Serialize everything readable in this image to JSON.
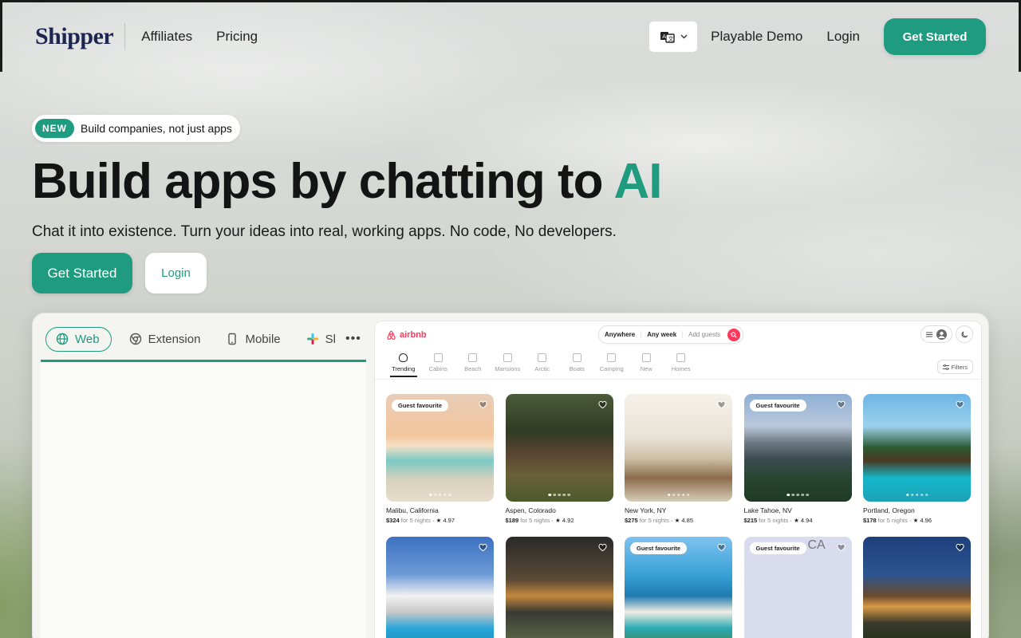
{
  "header": {
    "logo": "Shipper",
    "nav": [
      "Affiliates",
      "Pricing"
    ],
    "language_icon": "translate-icon",
    "playable_demo": "Playable Demo",
    "login": "Login",
    "get_started": "Get Started"
  },
  "hero": {
    "badge_label": "NEW",
    "badge_text": "Build companies, not just apps",
    "title_main": "Build apps by chatting to ",
    "title_accent": "AI",
    "subtitle": "Chat it into existence. Turn your ideas into real, working apps. No code, No developers.",
    "cta_primary": "Get Started",
    "cta_secondary": "Login"
  },
  "demo": {
    "tabs": [
      {
        "label": "Web",
        "icon": "globe-icon",
        "active": true
      },
      {
        "label": "Extension",
        "icon": "chrome-icon",
        "active": false
      },
      {
        "label": "Mobile",
        "icon": "phone-icon",
        "active": false
      },
      {
        "label": "Sl",
        "icon": "slack-icon",
        "active": false
      }
    ],
    "more": "•••",
    "accent_color": "#1f9b7f"
  },
  "airbnb": {
    "logo": "airbnb",
    "search": {
      "anywhere": "Anywhere",
      "week": "Any week",
      "guests": "Add guests"
    },
    "categories": [
      "Trending",
      "Cabins",
      "Beach",
      "Mansions",
      "Arctic",
      "Boats",
      "Camping",
      "New",
      "Homes"
    ],
    "filters": "Filters",
    "listings": [
      {
        "loc": "Malibu, California",
        "price": "$324",
        "nights": "for 5 nights",
        "rating": "4.97",
        "fav": "Guest favourite"
      },
      {
        "loc": "Aspen, Colorado",
        "price": "$189",
        "nights": "for 5 nights",
        "rating": "4.92",
        "fav": ""
      },
      {
        "loc": "New York, NY",
        "price": "$275",
        "nights": "for 5 nights",
        "rating": "4.85",
        "fav": ""
      },
      {
        "loc": "Lake Tahoe, NV",
        "price": "$215",
        "nights": "for 5 nights",
        "rating": "4.94",
        "fav": "Guest favourite"
      },
      {
        "loc": "Portland, Oregon",
        "price": "$178",
        "nights": "for 5 nights",
        "rating": "4.96",
        "fav": ""
      }
    ],
    "row2_favs": [
      "",
      "",
      "Guest favourite",
      "Guest favourite",
      ""
    ],
    "broken_img_text": "CA"
  }
}
